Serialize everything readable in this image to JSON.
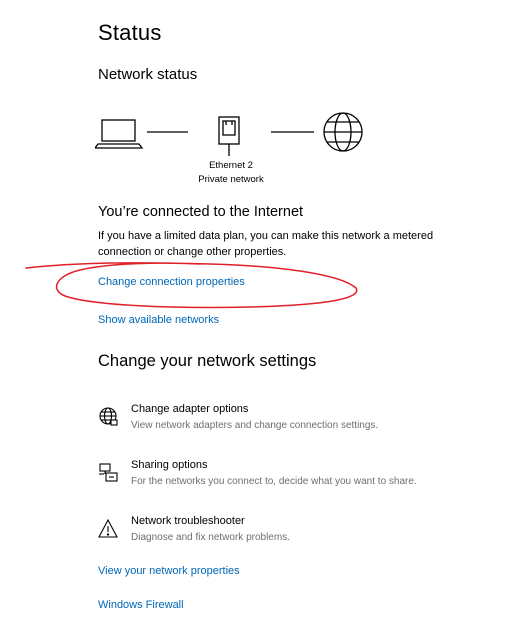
{
  "page": {
    "title": "Status"
  },
  "network_status": {
    "heading": "Network status",
    "adapter_name": "Ethernet 2",
    "network_type": "Private network",
    "icons": [
      "laptop-icon",
      "ethernet-icon",
      "globe-icon"
    ]
  },
  "connection": {
    "heading": "You’re connected to the Internet",
    "description": "If you have a limited data plan, you can make this network a metered connection or change other properties.",
    "change_properties_link": "Change connection properties",
    "show_networks_link": "Show available networks"
  },
  "settings": {
    "heading": "Change your network settings",
    "items": [
      {
        "icon": "globe-icon",
        "title": "Change adapter options",
        "description": "View network adapters and change connection settings."
      },
      {
        "icon": "sharing-icon",
        "title": "Sharing options",
        "description": "For the networks you connect to, decide what you want to share."
      },
      {
        "icon": "warning-icon",
        "title": "Network troubleshooter",
        "description": "Diagnose and fix network problems."
      }
    ]
  },
  "footer_links": {
    "view_properties": "View your network properties",
    "firewall": "Windows Firewall"
  },
  "colors": {
    "link": "#0067b8",
    "annotation": "#e0202a",
    "secondary_text": "#6e6e6e"
  }
}
